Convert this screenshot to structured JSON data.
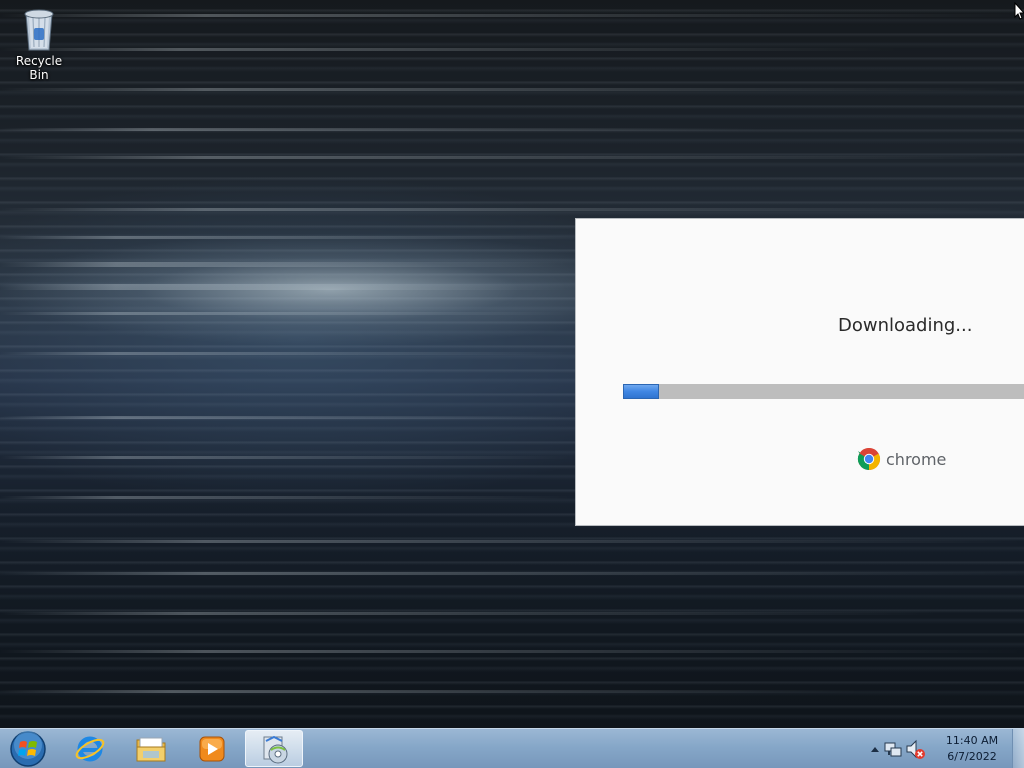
{
  "desktop": {
    "icons": [
      {
        "label": "Recycle Bin",
        "icon": "recycle-bin-icon"
      }
    ]
  },
  "installer": {
    "status_text": "Downloading...",
    "progress_fraction": 0.09,
    "brand_name": "chrome",
    "brand_icon": "chrome-logo-icon"
  },
  "taskbar": {
    "start_icon": "windows-start-orb-icon",
    "pinned": [
      {
        "icon": "internet-explorer-icon",
        "active": false
      },
      {
        "icon": "file-explorer-icon",
        "active": false
      },
      {
        "icon": "media-player-icon",
        "active": false
      },
      {
        "icon": "installer-app-icon",
        "active": true
      }
    ],
    "tray_icons": [
      "show-hidden-icons-arrow-icon",
      "network-icon",
      "volume-muted-icon"
    ],
    "clock": {
      "time": "11:40 AM",
      "date": "6/7/2022"
    }
  },
  "colors": {
    "progress_fill": "#3f86e3",
    "progress_track": "#bdbdbd",
    "taskbar": "#86a7c8"
  }
}
